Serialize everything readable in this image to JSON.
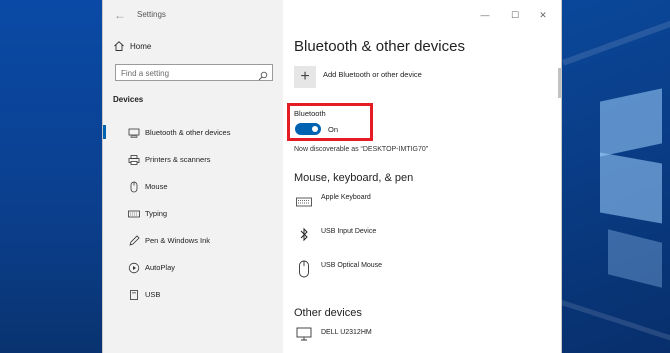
{
  "window": {
    "title": "Settings",
    "controls": {
      "minimize": "—",
      "maximize": "☐",
      "close": "✕"
    }
  },
  "sidebar": {
    "back_icon": "←",
    "home_label": "Home",
    "search_placeholder": "Find a setting",
    "section": "Devices",
    "items": [
      {
        "label": "Bluetooth & other devices",
        "icon": "bluetooth-devices-icon",
        "active": true
      },
      {
        "label": "Printers & scanners",
        "icon": "printer-icon",
        "active": false
      },
      {
        "label": "Mouse",
        "icon": "mouse-icon",
        "active": false
      },
      {
        "label": "Typing",
        "icon": "keyboard-icon",
        "active": false
      },
      {
        "label": "Pen & Windows Ink",
        "icon": "pen-icon",
        "active": false
      },
      {
        "label": "AutoPlay",
        "icon": "autoplay-icon",
        "active": false
      },
      {
        "label": "USB",
        "icon": "usb-icon",
        "active": false
      }
    ]
  },
  "main": {
    "title": "Bluetooth & other devices",
    "add_device_label": "Add Bluetooth or other device",
    "bluetooth_label": "Bluetooth",
    "bluetooth_state": "On",
    "discoverable_text": "Now discoverable as “DESKTOP-IMTIG70”",
    "section_input": "Mouse, keyboard, & pen",
    "input_devices": [
      {
        "label": "Apple Keyboard",
        "icon": "keyboard-icon"
      },
      {
        "label": "USB Input Device",
        "icon": "bluetooth-icon"
      },
      {
        "label": "USB Optical Mouse",
        "icon": "mouse-icon"
      }
    ],
    "section_other": "Other devices",
    "other_devices": [
      {
        "label": "DELL U2312HM",
        "icon": "monitor-icon"
      }
    ]
  },
  "colors": {
    "accent": "#0063b1",
    "highlight": "#e51c23"
  }
}
